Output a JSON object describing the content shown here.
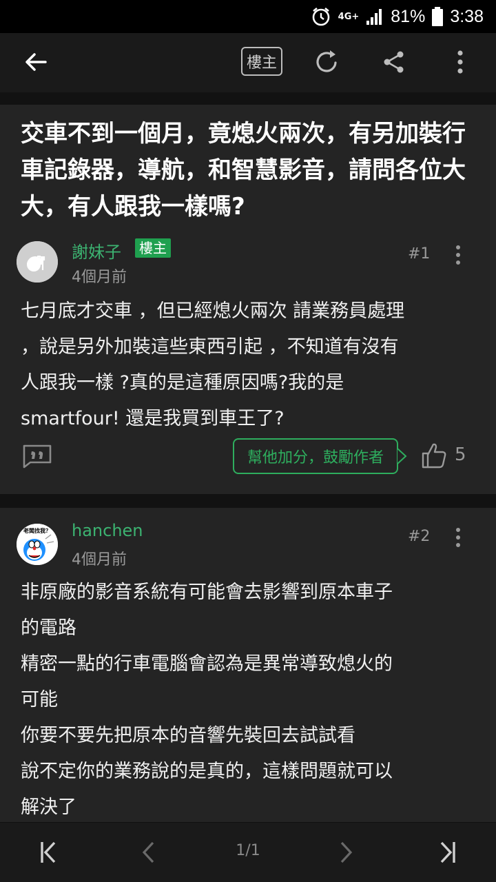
{
  "status_bar": {
    "network": "4G+",
    "battery": "81%",
    "time": "3:38"
  },
  "app_bar": {
    "owner_label": "樓主"
  },
  "thread": {
    "title": "交車不到一個月，竟熄火兩次，有另加裝行車記錄器，導航，和智慧影音，請問各位大大，有人跟我一樣嗎?"
  },
  "posts": [
    {
      "author": "謝妹子",
      "badge": "樓主",
      "time": "4個月前",
      "floor": "#1",
      "lines": [
        "七月底才交車 ，但已經熄火兩次 請業務員處理",
        "，說是另外加裝這些東西引起 ，不知道有沒有",
        "人跟我一樣 ?真的是這種原因嗎?我的是",
        "smartfour! 還是我買到車王了?"
      ],
      "cheer_label": "幫他加分，鼓勵作者",
      "likes": "5"
    },
    {
      "author": "hanchen",
      "avatar_caption": "老闆找我？",
      "time": "4個月前",
      "floor": "#2",
      "lines": [
        "非原廠的影音系統有可能會去影響到原本車子",
        "的電路",
        "精密一點的行車電腦會認為是異常導致熄火的",
        "可能",
        "你要不要先把原本的音響先裝回去試試看",
        "說不定你的業務說的是真的，這樣問題就可以",
        "解決了"
      ]
    }
  ],
  "pagination": {
    "indicator": "1/1"
  },
  "colors": {
    "accent": "#2eae5e",
    "background": "#242424",
    "bar": "#1a1a1a"
  }
}
